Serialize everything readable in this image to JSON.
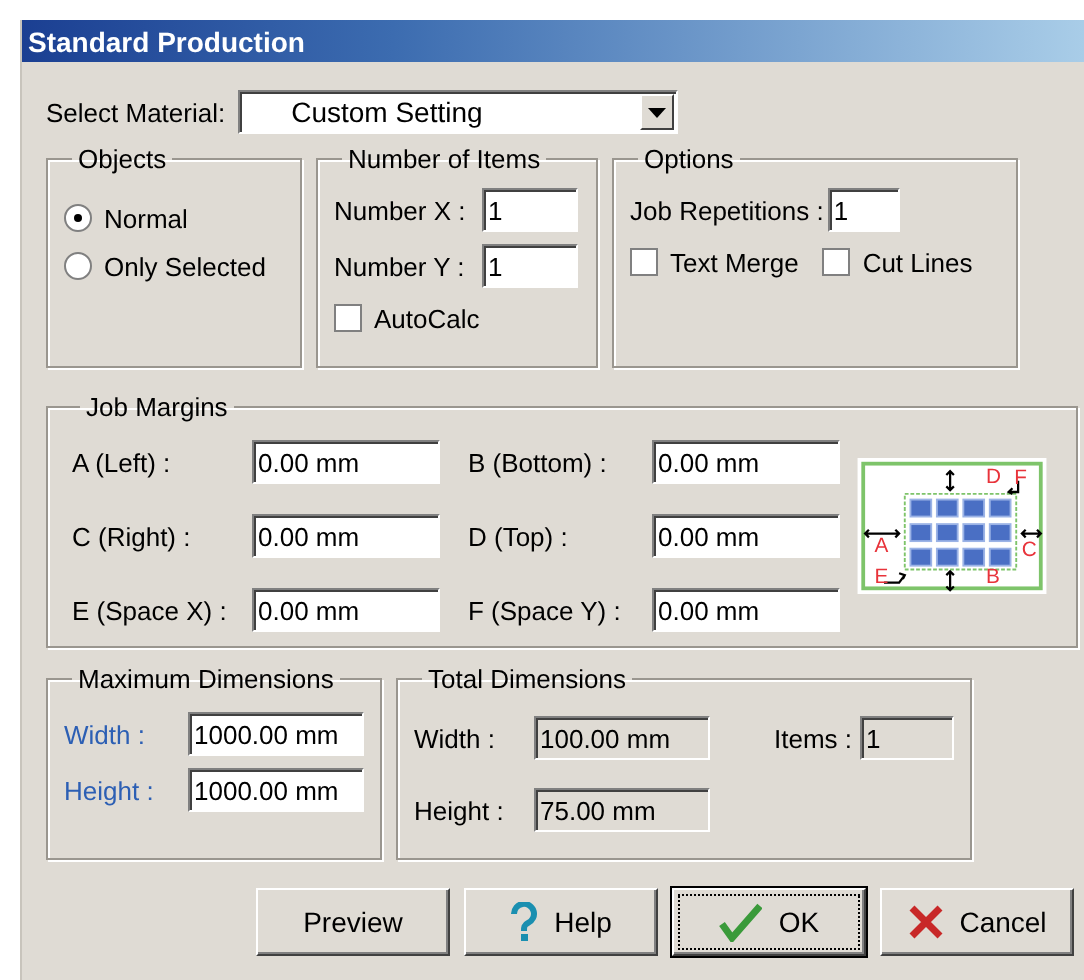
{
  "window": {
    "title": "Standard Production"
  },
  "select_material": {
    "label": "Select Material:",
    "value": "Custom Setting"
  },
  "objects": {
    "title": "Objects",
    "options": [
      {
        "label": "Normal",
        "selected": true
      },
      {
        "label": "Only Selected",
        "selected": false
      }
    ]
  },
  "number_of_items": {
    "title": "Number of Items",
    "fields": [
      {
        "label": "Number X :",
        "value": "1"
      },
      {
        "label": "Number Y :",
        "value": "1"
      }
    ],
    "autocalc": {
      "label": "AutoCalc",
      "checked": false
    }
  },
  "options": {
    "title": "Options",
    "job_repetitions": {
      "label": "Job Repetitions :",
      "value": "1"
    },
    "checkboxes": [
      {
        "label": "Text Merge",
        "checked": false
      },
      {
        "label": "Cut Lines",
        "checked": false
      }
    ]
  },
  "job_margins": {
    "title": "Job Margins",
    "fields": [
      {
        "label": "A (Left) :",
        "value": "0.00 mm"
      },
      {
        "label": "B (Bottom) :",
        "value": "0.00 mm"
      },
      {
        "label": "C (Right) :",
        "value": "0.00 mm"
      },
      {
        "label": "D (Top) :",
        "value": "0.00 mm"
      },
      {
        "label": "E (Space X) :",
        "value": "0.00 mm"
      },
      {
        "label": "F (Space Y) :",
        "value": "0.00 mm"
      }
    ],
    "diagram_labels": [
      "D",
      "F",
      "A",
      "C",
      "E",
      "B"
    ]
  },
  "maximum_dimensions": {
    "title": "Maximum Dimensions",
    "fields": [
      {
        "label": "Width :",
        "value": "1000.00 mm"
      },
      {
        "label": "Height :",
        "value": "1000.00 mm"
      }
    ]
  },
  "total_dimensions": {
    "title": "Total Dimensions",
    "fields": [
      {
        "label": "Width :",
        "value": "100.00 mm"
      },
      {
        "label": "Height :",
        "value": "75.00 mm"
      }
    ],
    "items": {
      "label": "Items :",
      "value": "1"
    }
  },
  "buttons": [
    {
      "label": "Preview",
      "kind": "plain",
      "focused": false
    },
    {
      "label": "Help",
      "kind": "help",
      "focused": false
    },
    {
      "label": "OK",
      "kind": "ok",
      "focused": true
    },
    {
      "label": "Cancel",
      "kind": "cancel",
      "focused": false
    }
  ]
}
